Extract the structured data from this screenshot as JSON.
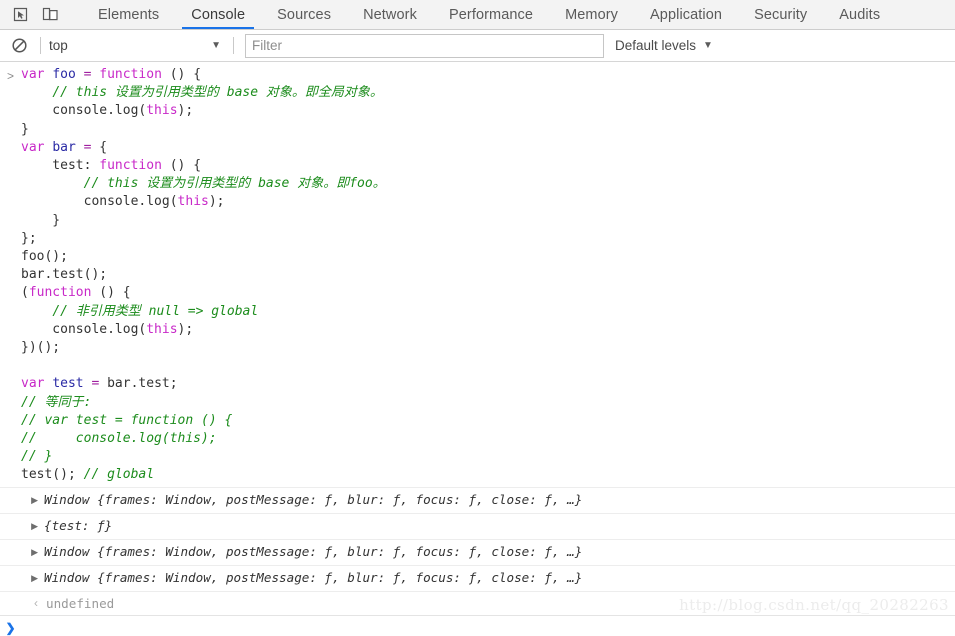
{
  "tabbar": {
    "icons": [
      {
        "name": "inspect-element-icon",
        "label": "Inspect element"
      },
      {
        "name": "device-toolbar-icon",
        "label": "Toggle device toolbar"
      }
    ],
    "tabs": [
      {
        "label": "Elements",
        "active": false
      },
      {
        "label": "Console",
        "active": true
      },
      {
        "label": "Sources",
        "active": false
      },
      {
        "label": "Network",
        "active": false
      },
      {
        "label": "Performance",
        "active": false
      },
      {
        "label": "Memory",
        "active": false
      },
      {
        "label": "Application",
        "active": false
      },
      {
        "label": "Security",
        "active": false
      },
      {
        "label": "Audits",
        "active": false
      }
    ],
    "active_tab": "Console",
    "accent_color": "#1a73e8"
  },
  "filterbar": {
    "clear_icon": "clear-console-icon",
    "context_value": "top",
    "context_caret": "▼",
    "filter_placeholder": "Filter",
    "filter_value": "",
    "levels_label": "Default levels",
    "levels_caret": "▼"
  },
  "console": {
    "input_prompt": ">",
    "code_lines": [
      "var foo = function () {",
      "    // this 设置为引用类型的 base 对象。即全局对象。",
      "    console.log(this);",
      "}",
      "var bar = {",
      "    test: function () {",
      "        // this 设置为引用类型的 base 对象。即foo。",
      "        console.log(this);",
      "    }",
      "};",
      "foo();",
      "bar.test();",
      "(function () {",
      "    // 非引用类型 null => global",
      "    console.log(this);",
      "})();",
      "",
      "var test = bar.test;",
      "// 等同于:",
      "// var test = function () {",
      "//     console.log(this);",
      "// }",
      "test(); // global"
    ],
    "outputs": [
      {
        "disclosure": "▶",
        "text": "Window {frames: Window, postMessage: ƒ, blur: ƒ, focus: ƒ, close: ƒ, …}"
      },
      {
        "disclosure": "▶",
        "text": "{test: ƒ}"
      },
      {
        "disclosure": "▶",
        "text": "Window {frames: Window, postMessage: ƒ, blur: ƒ, focus: ƒ, close: ƒ, …}"
      },
      {
        "disclosure": "▶",
        "text": "Window {frames: Window, postMessage: ƒ, blur: ƒ, focus: ƒ, close: ƒ, …}"
      }
    ],
    "return_arrow": "‹",
    "return_value": "undefined",
    "bottom_prompt": "❯"
  },
  "watermark": "http://blog.csdn.net/qq_20282263"
}
